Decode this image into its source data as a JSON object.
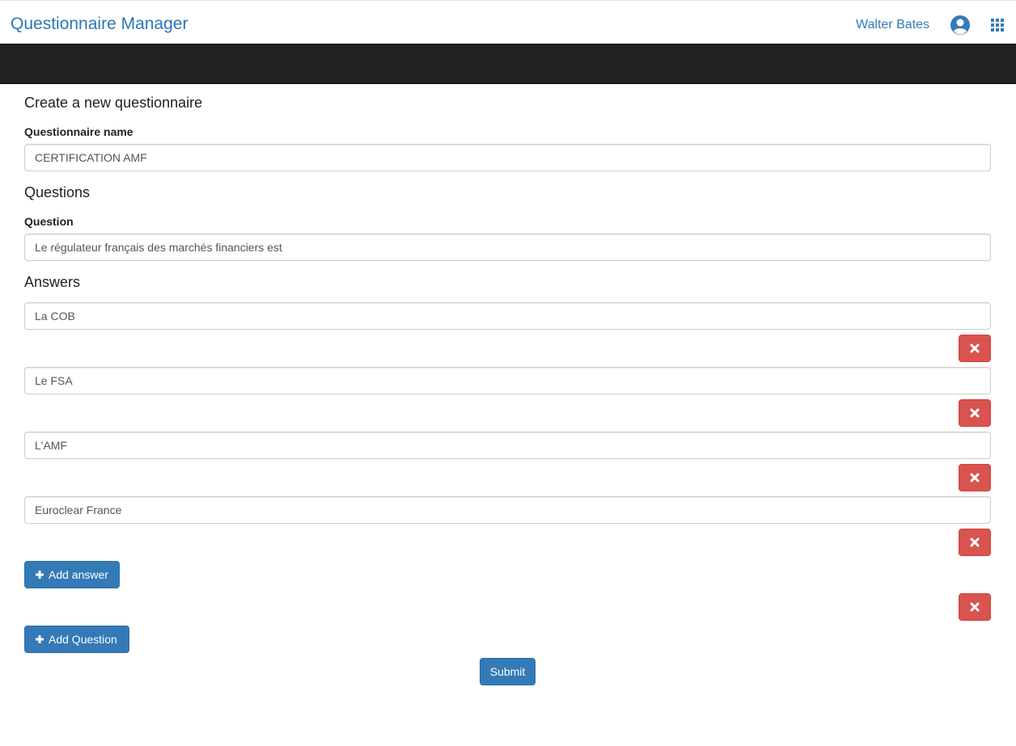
{
  "header": {
    "app_title": "Questionnaire Manager",
    "user_name": "Walter Bates",
    "brand_color": "#2e75b6",
    "icons": [
      "user-circle-icon",
      "apps-grid-icon"
    ]
  },
  "form": {
    "heading": "Create a new questionnaire",
    "name_label": "Questionnaire name",
    "name_value": "CERTIFICATION AMF",
    "questions_heading": "Questions",
    "question_label": "Question",
    "question_value": "Le régulateur français des marchés financiers est",
    "answers_heading": "Answers",
    "answers": [
      {
        "value": "La COB"
      },
      {
        "value": "Le FSA"
      },
      {
        "value": "L'AMF"
      },
      {
        "value": "Euroclear France"
      }
    ],
    "add_answer_label": "Add answer",
    "add_question_label": "Add Question",
    "submit_label": "Submit"
  },
  "colors": {
    "primary": "#337ab7",
    "danger": "#d9534f",
    "navbar_dark": "#222222"
  }
}
